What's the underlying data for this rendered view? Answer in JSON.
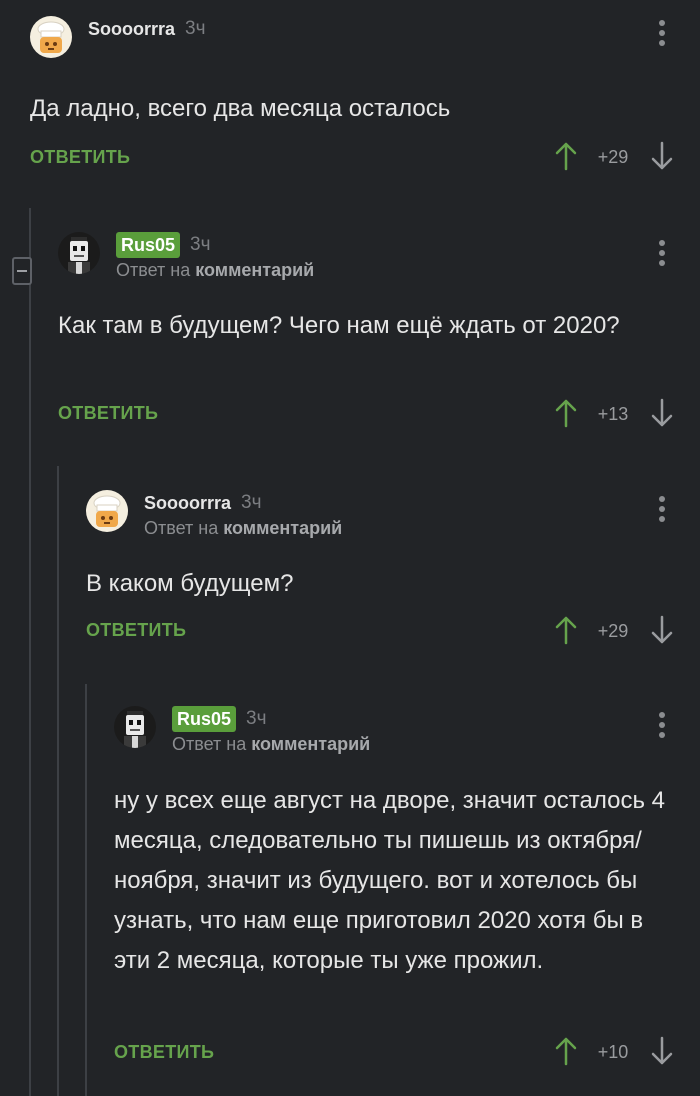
{
  "colors": {
    "background": "#222427",
    "accent_green": "#66a34c",
    "badge_green": "#5a9e3b",
    "text": "#e6e6e6",
    "muted": "#8b8d90"
  },
  "comments": [
    {
      "author": "Soooorrra",
      "author_is_badge": false,
      "avatar_icon": "chef-avatar-icon",
      "time": "3ч",
      "body": "Да ладно, всего два месяца осталось",
      "reply_label": "ОТВЕТИТЬ",
      "rating": "+29",
      "reply_to": null
    },
    {
      "author": "Rus05",
      "author_is_badge": true,
      "avatar_icon": "skeleton-avatar-icon",
      "time": "3ч",
      "reply_to": {
        "prefix": "Ответ на",
        "link": "комментарий"
      },
      "body": "Как там в будущем? Чего нам ещё ждать от 2020?",
      "reply_label": "ОТВЕТИТЬ",
      "rating": "+13"
    },
    {
      "author": "Soooorrra",
      "author_is_badge": false,
      "avatar_icon": "chef-avatar-icon",
      "time": "3ч",
      "reply_to": {
        "prefix": "Ответ на",
        "link": "комментарий"
      },
      "body": "В каком будущем?",
      "reply_label": "ОТВЕТИТЬ",
      "rating": "+29"
    },
    {
      "author": "Rus05",
      "author_is_badge": true,
      "avatar_icon": "skeleton-avatar-icon",
      "time": "3ч",
      "reply_to": {
        "prefix": "Ответ на",
        "link": "комментарий"
      },
      "body": "ну у всех еще август на дворе, значит осталось 4 месяца, следовательно ты пишешь из октября/ноября, значит из будущего. вот и хотелось бы узнать, что нам еще приготовил 2020 хотя бы в эти 2 месяца, которые ты уже прожил.",
      "reply_label": "ОТВЕТИТЬ",
      "rating": "+10"
    }
  ]
}
